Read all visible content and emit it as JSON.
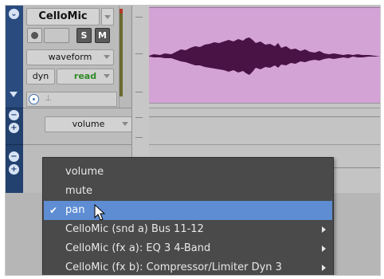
{
  "track": {
    "name": "CelloMic",
    "buttons": {
      "solo": "S",
      "mute": "M"
    },
    "view_selector": "waveform",
    "dyn_label": "dyn",
    "automation_mode": "read"
  },
  "automation_lane": {
    "selected": "volume"
  },
  "menu": {
    "items": [
      {
        "label": "volume",
        "checked": false,
        "submenu": false
      },
      {
        "label": "mute",
        "checked": false,
        "submenu": false
      },
      {
        "label": "pan",
        "checked": true,
        "submenu": false,
        "highlighted": true
      },
      {
        "label": "CelloMic  (snd a) Bus 11-12",
        "checked": false,
        "submenu": true
      },
      {
        "label": "CelloMic  (fx a): EQ 3 4-Band",
        "checked": false,
        "submenu": true
      },
      {
        "label": "CelloMic  (fx b): Compressor/Limiter Dyn 3",
        "checked": false,
        "submenu": true
      }
    ],
    "check_glyph": "✔"
  },
  "colors": {
    "clip_fill": "#d4a3d6",
    "waveform": "#4a1346",
    "menu_bg": "#4a4a4a",
    "menu_highlight": "#5f8dd3",
    "read_mode": "#2f8a26"
  }
}
